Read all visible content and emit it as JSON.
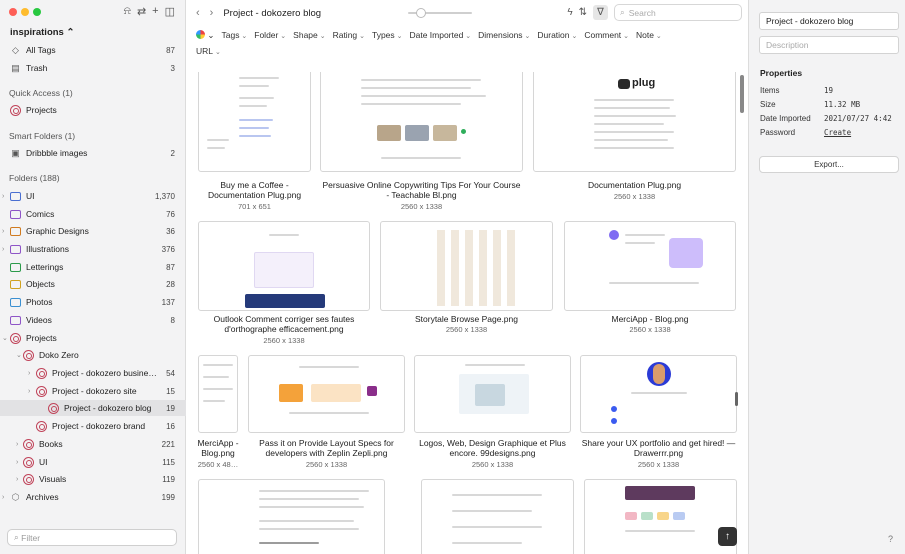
{
  "sidebar": {
    "library_name": "inspirations ⌃",
    "top": [
      {
        "label": "All Tags",
        "count": "87"
      },
      {
        "label": "Trash",
        "count": "3"
      }
    ],
    "quick_access_title": "Quick Access (1)",
    "quick_access": [
      {
        "label": "Projects"
      }
    ],
    "smart_title": "Smart Folders (1)",
    "smart": [
      {
        "label": "Dribbble images",
        "count": "2"
      }
    ],
    "folders_title": "Folders (188)",
    "folders": [
      {
        "label": "UI",
        "count": "1,370",
        "color": "#4a6fd1"
      },
      {
        "label": "Comics",
        "count": "76",
        "color": "#8e55c7"
      },
      {
        "label": "Graphic Designs",
        "count": "36",
        "color": "#d07a1f"
      },
      {
        "label": "Illustrations",
        "count": "376",
        "color": "#8e55c7"
      },
      {
        "label": "Letterings",
        "count": "87",
        "color": "#2b9a4a"
      },
      {
        "label": "Objects",
        "count": "28",
        "color": "#d0a21f"
      },
      {
        "label": "Photos",
        "count": "137",
        "color": "#3a8fd1"
      },
      {
        "label": "Videos",
        "count": "8",
        "color": "#8e55c7"
      },
      {
        "label": "Projects",
        "count": ""
      },
      {
        "label": "Doko Zero",
        "count": ""
      },
      {
        "label": "Project - dokozero busine…",
        "count": "54"
      },
      {
        "label": "Project - dokozero site",
        "count": "15"
      },
      {
        "label": "Project - dokozero blog",
        "count": "19"
      },
      {
        "label": "Project - dokozero brand",
        "count": "16"
      },
      {
        "label": "Books",
        "count": "221"
      },
      {
        "label": "UI",
        "count": "115"
      },
      {
        "label": "Visuals",
        "count": "119"
      },
      {
        "label": "Archives",
        "count": "199"
      }
    ],
    "filter_placeholder": "Filter"
  },
  "toolbar": {
    "back": "‹",
    "forward": "›",
    "breadcrumb": "Project - dokozero blog",
    "search_placeholder": "Search"
  },
  "filters": [
    "Tags",
    "Folder",
    "Shape",
    "Rating",
    "Types",
    "Date Imported",
    "Dimensions",
    "Duration",
    "Comment",
    "Note",
    "URL"
  ],
  "items": [
    {
      "name": "Buy me a Coffee - Documentation Plug.png",
      "dims": "701 x 651"
    },
    {
      "name": "Persuasive Online Copywriting Tips For Your Course - Teachable Bl.png",
      "dims": "2560 x 1338"
    },
    {
      "name": "Documentation Plug.png",
      "dims": "2560 x 1338"
    },
    {
      "name": "Outlook Comment corriger ses fautes d'orthographe efficacement.png",
      "dims": "2560 x 1338"
    },
    {
      "name": "Storytale Browse Page.png",
      "dims": "2560 x 1338"
    },
    {
      "name": "MerciApp - Blog.png",
      "dims": "2560 x 1338"
    },
    {
      "name": "MerciApp - Blog.png",
      "dims": "2560 x 48…"
    },
    {
      "name": "Pass it on Provide Layout Specs for developers with Zeplin Zepli.png",
      "dims": "2560 x 1338"
    },
    {
      "name": "Logos, Web, Design Graphique et Plus encore. 99designs.png",
      "dims": "2560 x 1338"
    },
    {
      "name": "Share your UX portfolio and get hired! — Drawerrr.png",
      "dims": "2560 x 1338"
    }
  ],
  "thumb_text": {
    "plug_logo": "plug"
  },
  "inspector": {
    "name": "Project - dokozero blog",
    "description_placeholder": "Description",
    "properties_title": "Properties",
    "props": [
      {
        "label": "Items",
        "value": "19"
      },
      {
        "label": "Size",
        "value": "11.32 MB"
      },
      {
        "label": "Date Imported",
        "value": "2021/07/27 4:42"
      },
      {
        "label": "Password",
        "value": "Create"
      }
    ],
    "export_label": "Export...",
    "help": "?"
  }
}
